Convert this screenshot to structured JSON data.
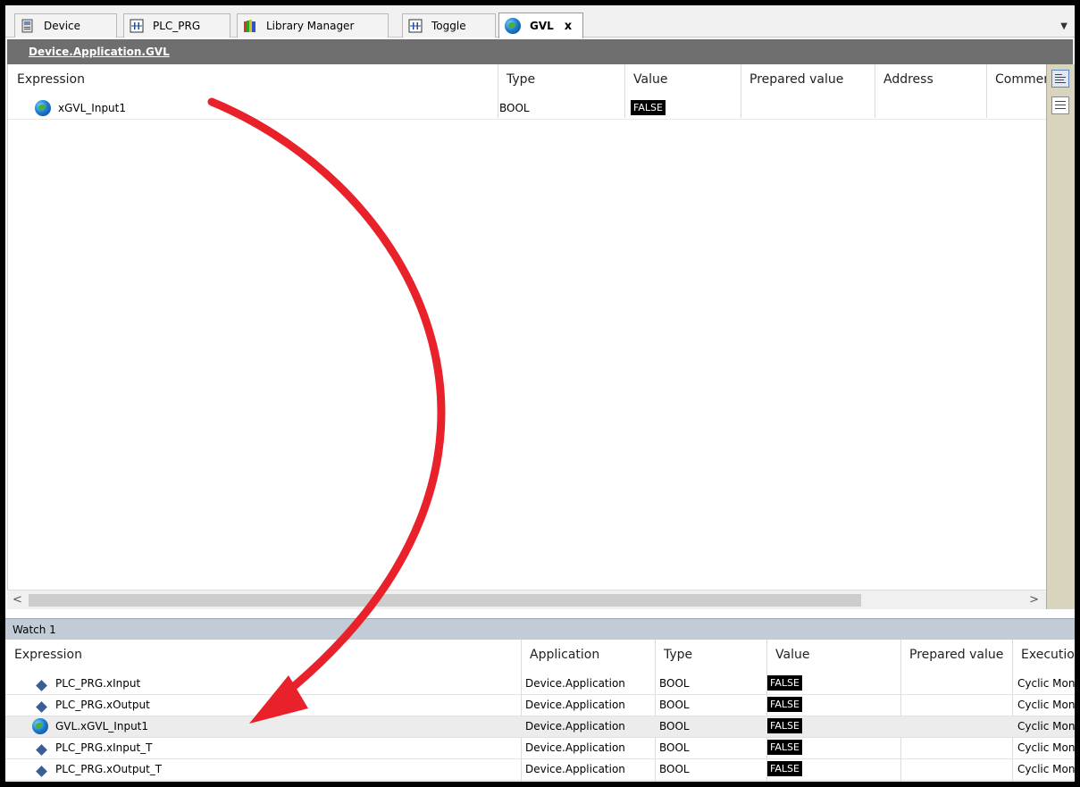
{
  "tabs": [
    {
      "label": "Device",
      "icon": "device-icon"
    },
    {
      "label": "PLC_PRG",
      "icon": "program-icon"
    },
    {
      "label": "Library Manager",
      "icon": "library-icon"
    },
    {
      "label": "Toggle",
      "icon": "program-icon"
    },
    {
      "label": "GVL",
      "icon": "globe-icon",
      "active": true,
      "close": "x"
    }
  ],
  "tab_dropdown": "▼",
  "path": "Device.Application.GVL",
  "upper": {
    "columns": [
      "Expression",
      "Type",
      "Value",
      "Prepared value",
      "Address",
      "Commer"
    ],
    "rows": [
      {
        "expression": "xGVL_Input1",
        "type": "BOOL",
        "value": "FALSE",
        "icon": "globe-icon"
      }
    ]
  },
  "scroll": {
    "left": "<",
    "right": ">"
  },
  "watch": {
    "title": "Watch 1",
    "columns": [
      "Expression",
      "Application",
      "Type",
      "Value",
      "Prepared value",
      "Execution"
    ],
    "rows": [
      {
        "expression": "PLC_PRG.xInput",
        "application": "Device.Application",
        "type": "BOOL",
        "value": "FALSE",
        "execution": "Cyclic Moni",
        "icon": "variable-diamond-icon"
      },
      {
        "expression": "PLC_PRG.xOutput",
        "application": "Device.Application",
        "type": "BOOL",
        "value": "FALSE",
        "execution": "Cyclic Moni",
        "icon": "variable-diamond-icon"
      },
      {
        "expression": "GVL.xGVL_Input1",
        "application": "Device.Application",
        "type": "BOOL",
        "value": "FALSE",
        "execution": "Cyclic Moni",
        "icon": "globe-icon"
      },
      {
        "expression": "PLC_PRG.xInput_T",
        "application": "Device.Application",
        "type": "BOOL",
        "value": "FALSE",
        "execution": "Cyclic Moni",
        "icon": "variable-diamond-icon"
      },
      {
        "expression": "PLC_PRG.xOutput_T",
        "application": "Device.Application",
        "type": "BOOL",
        "value": "FALSE",
        "execution": "Cyclic Moni",
        "icon": "variable-diamond-icon"
      }
    ]
  },
  "colors": {
    "annotation_arrow": "#e8212a",
    "path_bar": "#6e6e6e",
    "watch_header": "#c2ccd6"
  }
}
